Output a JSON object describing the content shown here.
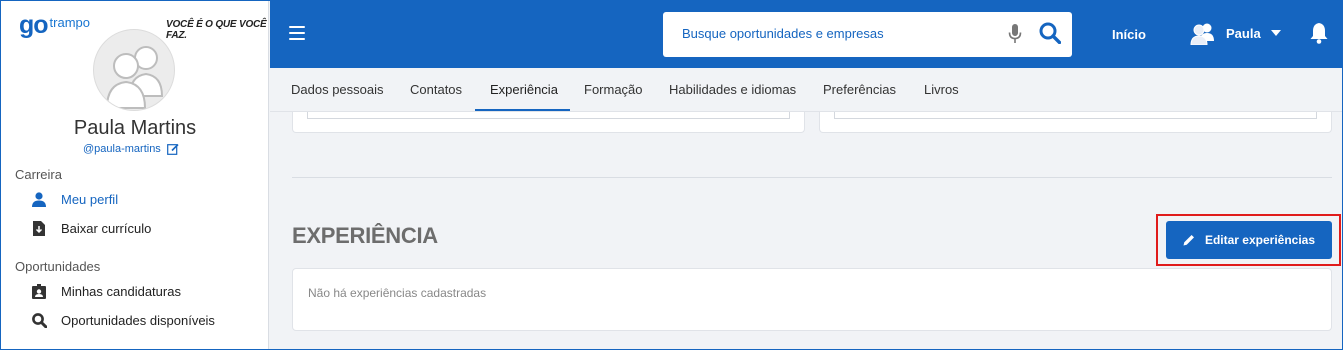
{
  "brand": {
    "logo_go": "go",
    "logo_trampo": "trampo",
    "slogan": "VOCÊ É O QUE VOCÊ FAZ."
  },
  "profile": {
    "name": "Paula Martins",
    "handle": "@paula-martins"
  },
  "sidebar": {
    "sections": [
      {
        "label": "Carreira",
        "items": [
          {
            "label": "Meu perfil",
            "icon": "person-icon"
          },
          {
            "label": "Baixar currículo",
            "icon": "download-file-icon"
          }
        ]
      },
      {
        "label": "Oportunidades",
        "items": [
          {
            "label": "Minhas candidaturas",
            "icon": "id-badge-icon"
          },
          {
            "label": "Oportunidades disponíveis",
            "icon": "search-doc-icon"
          }
        ]
      }
    ]
  },
  "topbar": {
    "search_placeholder": "Busque oportunidades e empresas",
    "home_label": "Início",
    "user_label": "Paula"
  },
  "tabs": [
    "Dados pessoais",
    "Contatos",
    "Experiência",
    "Formação",
    "Habilidades e idiomas",
    "Preferências",
    "Livros"
  ],
  "active_tab": "Experiência",
  "experience": {
    "title": "EXPERIÊNCIA",
    "edit_button": "Editar experiências",
    "empty_message": "Não há experiências cadastradas"
  },
  "colors": {
    "primary": "#1565c0",
    "highlight": "#e01b1b"
  }
}
